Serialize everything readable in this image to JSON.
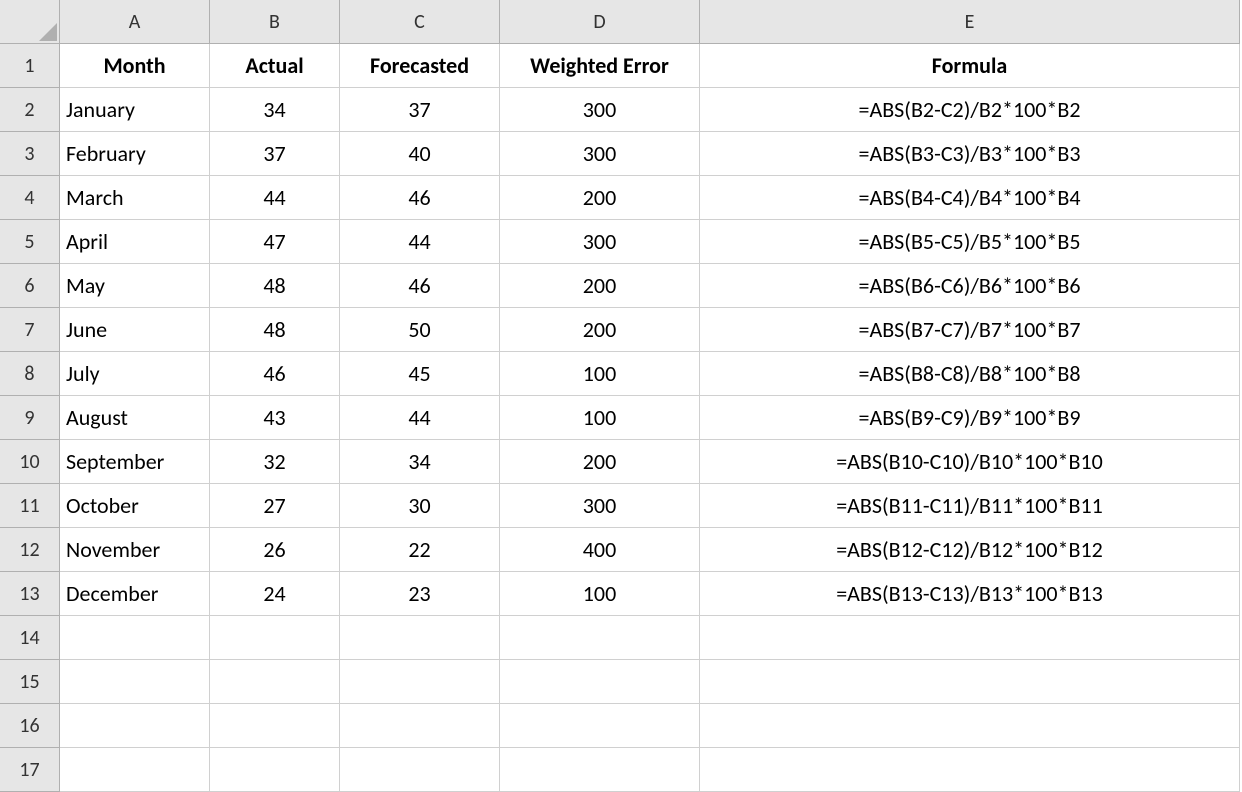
{
  "columns": [
    "A",
    "B",
    "C",
    "D",
    "E"
  ],
  "rowNumbers": [
    "1",
    "2",
    "3",
    "4",
    "5",
    "6",
    "7",
    "8",
    "9",
    "10",
    "11",
    "12",
    "13",
    "14",
    "15",
    "16",
    "17"
  ],
  "headers": {
    "A": "Month",
    "B": "Actual",
    "C": "Forecasted",
    "D": "Weighted Error",
    "E": "Formula"
  },
  "rows": [
    {
      "month": "January",
      "actual": "34",
      "forecasted": "37",
      "werr": "300",
      "formula": "=ABS(B2-C2)/B2*100*B2"
    },
    {
      "month": "February",
      "actual": "37",
      "forecasted": "40",
      "werr": "300",
      "formula": "=ABS(B3-C3)/B3*100*B3"
    },
    {
      "month": "March",
      "actual": "44",
      "forecasted": "46",
      "werr": "200",
      "formula": "=ABS(B4-C4)/B4*100*B4"
    },
    {
      "month": "April",
      "actual": "47",
      "forecasted": "44",
      "werr": "300",
      "formula": "=ABS(B5-C5)/B5*100*B5"
    },
    {
      "month": "May",
      "actual": "48",
      "forecasted": "46",
      "werr": "200",
      "formula": "=ABS(B6-C6)/B6*100*B6"
    },
    {
      "month": "June",
      "actual": "48",
      "forecasted": "50",
      "werr": "200",
      "formula": "=ABS(B7-C7)/B7*100*B7"
    },
    {
      "month": "July",
      "actual": "46",
      "forecasted": "45",
      "werr": "100",
      "formula": "=ABS(B8-C8)/B8*100*B8"
    },
    {
      "month": "August",
      "actual": "43",
      "forecasted": "44",
      "werr": "100",
      "formula": "=ABS(B9-C9)/B9*100*B9"
    },
    {
      "month": "September",
      "actual": "32",
      "forecasted": "34",
      "werr": "200",
      "formula": "=ABS(B10-C10)/B10*100*B10"
    },
    {
      "month": "October",
      "actual": "27",
      "forecasted": "30",
      "werr": "300",
      "formula": "=ABS(B11-C11)/B11*100*B11"
    },
    {
      "month": "November",
      "actual": "26",
      "forecasted": "22",
      "werr": "400",
      "formula": "=ABS(B12-C12)/B12*100*B12"
    },
    {
      "month": "December",
      "actual": "24",
      "forecasted": "23",
      "werr": "100",
      "formula": "=ABS(B13-C13)/B13*100*B13"
    }
  ]
}
